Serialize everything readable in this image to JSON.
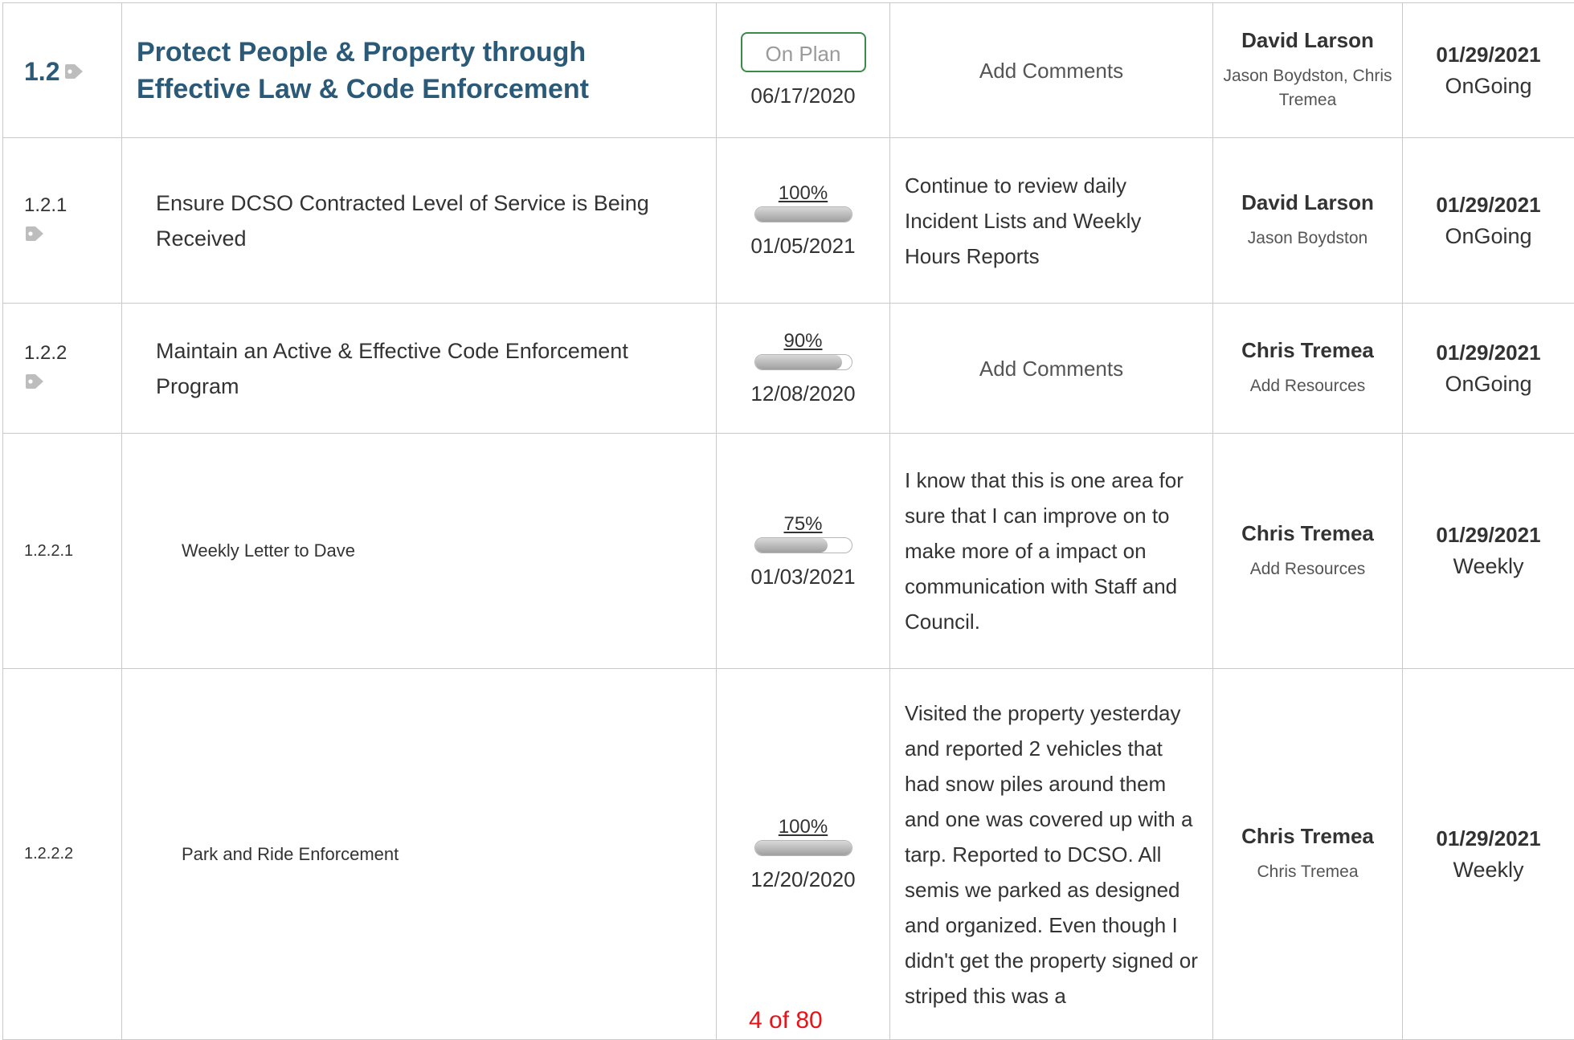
{
  "rows": [
    {
      "number": "1.2",
      "title": "Protect People & Property through Effective Law & Code Enforcement",
      "status": "On Plan",
      "date": "06/17/2020",
      "comment": "Add Comments",
      "owner": "David Larson",
      "resources": "Jason Boydston, Chris Tremea",
      "due_date": "01/29/2021",
      "frequency": "OnGoing"
    },
    {
      "number": "1.2.1",
      "title": "Ensure DCSO Contracted Level of Service is Being Received",
      "progress_label": "100%",
      "progress": 1.0,
      "date": "01/05/2021",
      "comment": "Continue to review daily Incident Lists and Weekly Hours Reports",
      "owner": "David Larson",
      "resources": "Jason Boydston",
      "due_date": "01/29/2021",
      "frequency": "OnGoing"
    },
    {
      "number": "1.2.2",
      "title": "Maintain an Active & Effective Code Enforcement Program",
      "progress_label": "90%",
      "progress": 0.9,
      "date": "12/08/2020",
      "comment": "Add Comments",
      "owner": "Chris Tremea",
      "resources": "Add Resources",
      "due_date": "01/29/2021",
      "frequency": "OnGoing"
    },
    {
      "number": "1.2.2.1",
      "title": "Weekly Letter to Dave",
      "progress_label": "75%",
      "progress": 0.75,
      "date": "01/03/2021",
      "comment": "I know that this is one area for sure that I can improve on to make more of a impact on communication with Staff and Council.",
      "owner": "Chris Tremea",
      "resources": "Add Resources",
      "due_date": "01/29/2021",
      "frequency": "Weekly"
    },
    {
      "number": "1.2.2.2",
      "title": "Park and Ride Enforcement",
      "progress_label": "100%",
      "progress": 1.0,
      "date": "12/20/2020",
      "comment": "Visited the property yesterday and reported 2 vehicles that had snow piles around them and one was covered up with a tarp.  Reported to DCSO.  All semis we parked as designed and organized.  Even though I didn't get the property signed or striped this was a",
      "owner": "Chris Tremea",
      "resources": "Chris Tremea",
      "due_date": "01/29/2021",
      "frequency": "Weekly"
    }
  ],
  "pager": "4 of 80",
  "icons": {
    "tag": "tag-icon"
  },
  "colors": {
    "heading": "#2b5a78",
    "on_plan_border": "#3a8a4a",
    "pager": "#e8141a",
    "tag": "#bdbdbd"
  }
}
